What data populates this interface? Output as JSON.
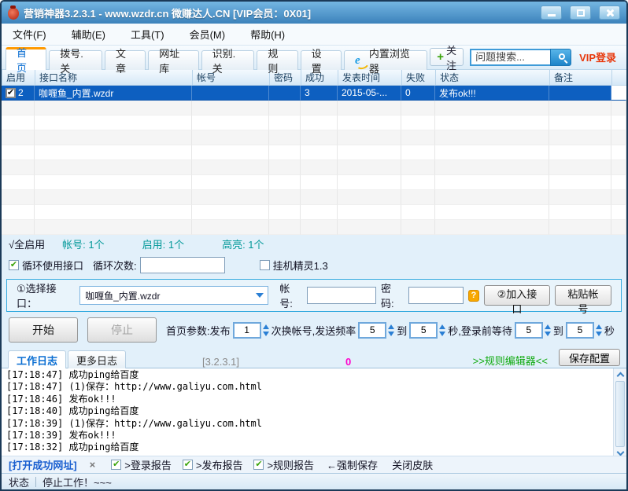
{
  "window": {
    "title": "营销神器3.2.3.1 - www.wzdr.cn 微赚达人.CN [VIP会员：0X01]"
  },
  "menu": {
    "items": [
      "文件(F)",
      "辅助(E)",
      "工具(T)",
      "会员(M)",
      "帮助(H)"
    ]
  },
  "tabbar": {
    "tabs": [
      "首页",
      "拨号.关",
      "文章",
      "网址库",
      "识别.关",
      "规则",
      "设置",
      "内置浏览器"
    ],
    "follow": {
      "plus": "+",
      "label": "关注"
    },
    "search_placeholder": "问题搜索...",
    "vip": "VIP登录"
  },
  "table": {
    "columns": [
      "启用",
      "接口名称",
      "帐号",
      "密码",
      "成功",
      "发表时间",
      "失败",
      "状态",
      "备注"
    ],
    "row": {
      "id": "2",
      "name": "咖喱鱼_内置.wzdr",
      "account": "",
      "password": "",
      "success": "3",
      "publish_time": "2015-05-...",
      "fail": "0",
      "status": "发布ok!!!",
      "remark": ""
    }
  },
  "summary": {
    "all_enable": "√全启用",
    "accounts": "帐号: 1个",
    "enabled": "启用: 1个",
    "highlight": "高亮: 1个"
  },
  "loop": {
    "use_loop": "循环使用接口",
    "loop_count_label": "循环次数:",
    "loop_count_value": "",
    "hang_label": "挂机精灵1.3"
  },
  "interface_panel": {
    "select_label": "①选择接口：",
    "selected_interface": "咖喱鱼_内置.wzdr",
    "account_label": "帐号:",
    "account_value": "",
    "password_label": "密码:",
    "password_value": "",
    "help": "?",
    "add_button": "②加入接口",
    "paste_button": "粘贴帐号"
  },
  "actions": {
    "start": "开始",
    "stop": "停止",
    "param_prefix": "首页参数:发布",
    "publish_count": "1",
    "between1": "次换帐号,发送频率",
    "freq_from": "5",
    "to1": "到",
    "freq_to": "5",
    "between2": "秒,登录前等待",
    "wait_from": "5",
    "to2": "到",
    "wait_to": "5",
    "suffix": "秒"
  },
  "log_section": {
    "tabs": [
      "工作日志",
      "更多日志"
    ],
    "version": "[3.2.3.1]",
    "counter": "0",
    "rule_editor": ">>规则编辑器<<",
    "save_config": "保存配置",
    "lines": [
      "[17:18:47] 成功ping给百度",
      "[17:18:47] (1)保存：http://www.galiyu.com.html",
      "[17:18:46] 发布ok!!!",
      "[17:18:40] 成功ping给百度",
      "[17:18:39] (1)保存：http://www.galiyu.com.html",
      "[17:18:39] 发布ok!!!",
      "[17:18:32] 成功ping给百度"
    ]
  },
  "bottom_toolbar": {
    "open_urls": "[打开成功网址]",
    "close_x": "×",
    "login_report": ">登录报告",
    "publish_report": ">发布报告",
    "rule_report": ">规则报告",
    "force_save": "←强制保存",
    "close_skin": "关闭皮肤"
  },
  "statusbar": {
    "label": "状态",
    "message": "停止工作！~~~"
  },
  "icons": {
    "app": "money-bag",
    "ie": "e",
    "search": "magnifier",
    "check": "✔",
    "dropdown": "triangle-down",
    "question": "?"
  },
  "colors": {
    "titlebar": "#4a94cc",
    "selected_row": "#0d5fc0",
    "teal": "#009898",
    "vip_red": "#e8380c",
    "green_check": "#3aa30a",
    "magenta": "#ff00cc",
    "rule_green": "#0faa0f",
    "tab_orange": "#ff9900"
  }
}
